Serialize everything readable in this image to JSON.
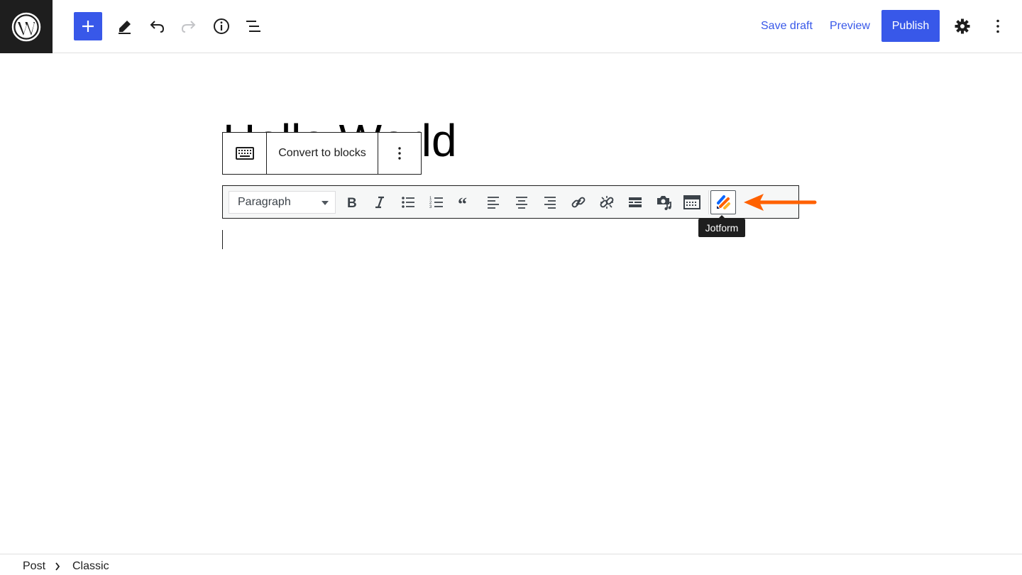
{
  "topbar": {
    "logo_icon": "wordpress-logo",
    "add_icon": "plus-icon",
    "tools_icon": "pencil-icon",
    "undo_icon": "undo-icon",
    "redo_icon": "redo-icon",
    "details_icon": "info-icon",
    "outline_icon": "list-view-icon",
    "save_draft_label": "Save draft",
    "preview_label": "Preview",
    "publish_label": "Publish",
    "settings_icon": "gear-icon",
    "options_icon": "more-vertical-icon",
    "accent_color": "#3858e9"
  },
  "post": {
    "title": "Hello World"
  },
  "block_toolbar": {
    "keyboard_icon": "keyboard-icon",
    "convert_label": "Convert to blocks",
    "more_icon": "more-vertical-icon"
  },
  "classic_toolbar": {
    "format_value": "Paragraph",
    "buttons": [
      "bold-icon",
      "italic-icon",
      "bulleted-list-icon",
      "numbered-list-icon",
      "blockquote-icon",
      "align-left-icon",
      "align-center-icon",
      "align-right-icon",
      "link-icon",
      "unlink-icon",
      "read-more-icon",
      "add-media-icon",
      "toolbar-toggle-icon"
    ],
    "jotform_icon": "jotform-icon",
    "tooltip": "Jotform",
    "annotation_color": "#ff6100"
  },
  "footer": {
    "crumb_1": "Post",
    "crumb_2": "Classic"
  }
}
